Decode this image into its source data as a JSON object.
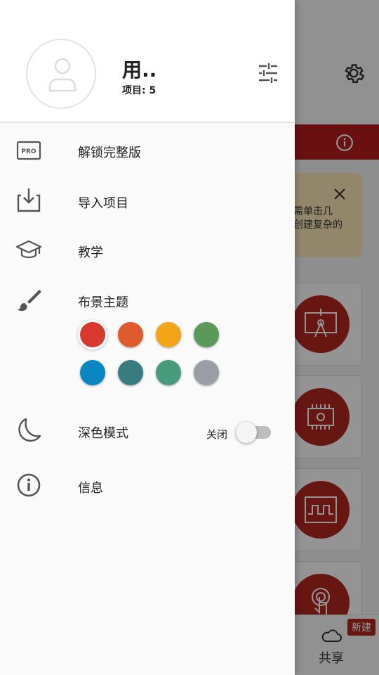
{
  "drawer": {
    "username": "用..",
    "project_count": "项目: 5",
    "menu": [
      {
        "label": "解锁完整版",
        "icon": "pro-badge-icon"
      },
      {
        "label": "导入项目",
        "icon": "import-icon"
      },
      {
        "label": "教学",
        "icon": "graduation-cap-icon"
      },
      {
        "label": "布景主题",
        "icon": "brush-icon"
      },
      {
        "label": "深色模式",
        "icon": "moon-icon"
      },
      {
        "label": "信息",
        "icon": "info-icon"
      }
    ],
    "pro_badge_text": "PRO",
    "theme_colors": [
      "#d9382f",
      "#e05a2b",
      "#f2a516",
      "#5a9a58",
      "#0a87c0",
      "#387c7f",
      "#469b7d",
      "#9a9ca6"
    ],
    "selected_theme_index": 0,
    "dark_mode": {
      "state_label": "关闭",
      "enabled": false
    }
  },
  "background": {
    "tip_text": "需单击几\n创建复杂的",
    "bottom_tab_label": "共享",
    "new_badge": "新建",
    "accent_color": "#b3261e"
  }
}
